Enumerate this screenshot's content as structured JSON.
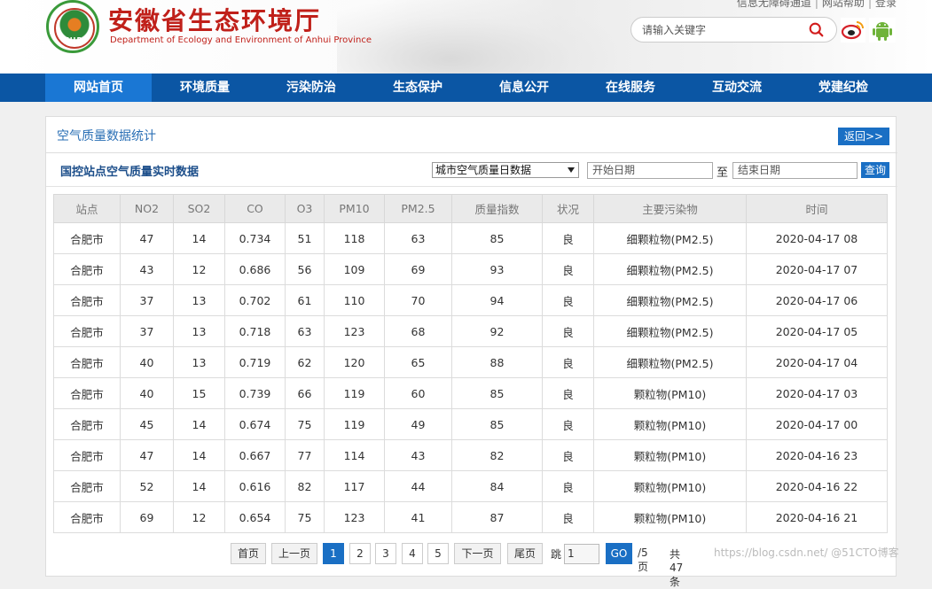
{
  "header": {
    "logo_text": "ZHB",
    "title": "安徽省生态环境厅",
    "subtitle": "Department of Ecology and Environment of Anhui Province",
    "top_links": [
      "信息无障碍通道",
      "网站帮助",
      "登录"
    ],
    "search_placeholder": "请输入关键字"
  },
  "nav": {
    "items": [
      "网站首页",
      "环境质量",
      "污染防治",
      "生态保护",
      "信息公开",
      "在线服务",
      "互动交流",
      "党建纪检"
    ],
    "active_index": 0
  },
  "panel": {
    "title": "空气质量数据统计",
    "back_label": "返回>>",
    "subtitle": "国控站点空气质量实时数据",
    "select_value": "城市空气质量日数据",
    "start_date_placeholder": "开始日期",
    "date_separator": "至",
    "end_date_placeholder": "结束日期",
    "query_label": "查询"
  },
  "table": {
    "headers": [
      "站点",
      "NO2",
      "SO2",
      "CO",
      "O3",
      "PM10",
      "PM2.5",
      "质量指数",
      "状况",
      "主要污染物",
      "时间"
    ],
    "rows": [
      [
        "合肥市",
        "47",
        "14",
        "0.734",
        "51",
        "118",
        "63",
        "85",
        "良",
        "细颗粒物(PM2.5)",
        "2020-04-17 08"
      ],
      [
        "合肥市",
        "43",
        "12",
        "0.686",
        "56",
        "109",
        "69",
        "93",
        "良",
        "细颗粒物(PM2.5)",
        "2020-04-17 07"
      ],
      [
        "合肥市",
        "37",
        "13",
        "0.702",
        "61",
        "110",
        "70",
        "94",
        "良",
        "细颗粒物(PM2.5)",
        "2020-04-17 06"
      ],
      [
        "合肥市",
        "37",
        "13",
        "0.718",
        "63",
        "123",
        "68",
        "92",
        "良",
        "细颗粒物(PM2.5)",
        "2020-04-17 05"
      ],
      [
        "合肥市",
        "40",
        "13",
        "0.719",
        "62",
        "120",
        "65",
        "88",
        "良",
        "细颗粒物(PM2.5)",
        "2020-04-17 04"
      ],
      [
        "合肥市",
        "40",
        "15",
        "0.739",
        "66",
        "119",
        "60",
        "85",
        "良",
        "颗粒物(PM10)",
        "2020-04-17 03"
      ],
      [
        "合肥市",
        "45",
        "14",
        "0.674",
        "75",
        "119",
        "49",
        "85",
        "良",
        "颗粒物(PM10)",
        "2020-04-17 00"
      ],
      [
        "合肥市",
        "47",
        "14",
        "0.667",
        "77",
        "114",
        "43",
        "82",
        "良",
        "颗粒物(PM10)",
        "2020-04-16 23"
      ],
      [
        "合肥市",
        "52",
        "14",
        "0.616",
        "82",
        "117",
        "44",
        "84",
        "良",
        "颗粒物(PM10)",
        "2020-04-16 22"
      ],
      [
        "合肥市",
        "69",
        "12",
        "0.654",
        "75",
        "123",
        "41",
        "87",
        "良",
        "颗粒物(PM10)",
        "2020-04-16 21"
      ]
    ]
  },
  "pager": {
    "first": "首页",
    "prev": "上一页",
    "pages": [
      "1",
      "2",
      "3",
      "4",
      "5"
    ],
    "current": "1",
    "next": "下一页",
    "last": "尾页",
    "jump_label": "跳",
    "jump_value": "1",
    "go_label": "GO",
    "total_pages": "/5页",
    "total_count": "共 47 条"
  },
  "watermark": "https://blog.csdn.net/ @51CTO博客",
  "colors": {
    "nav_bg": "#0b56a4",
    "nav_active": "#1a77d4",
    "brand_red": "#c0201a",
    "button_blue": "#1a6fc4"
  }
}
